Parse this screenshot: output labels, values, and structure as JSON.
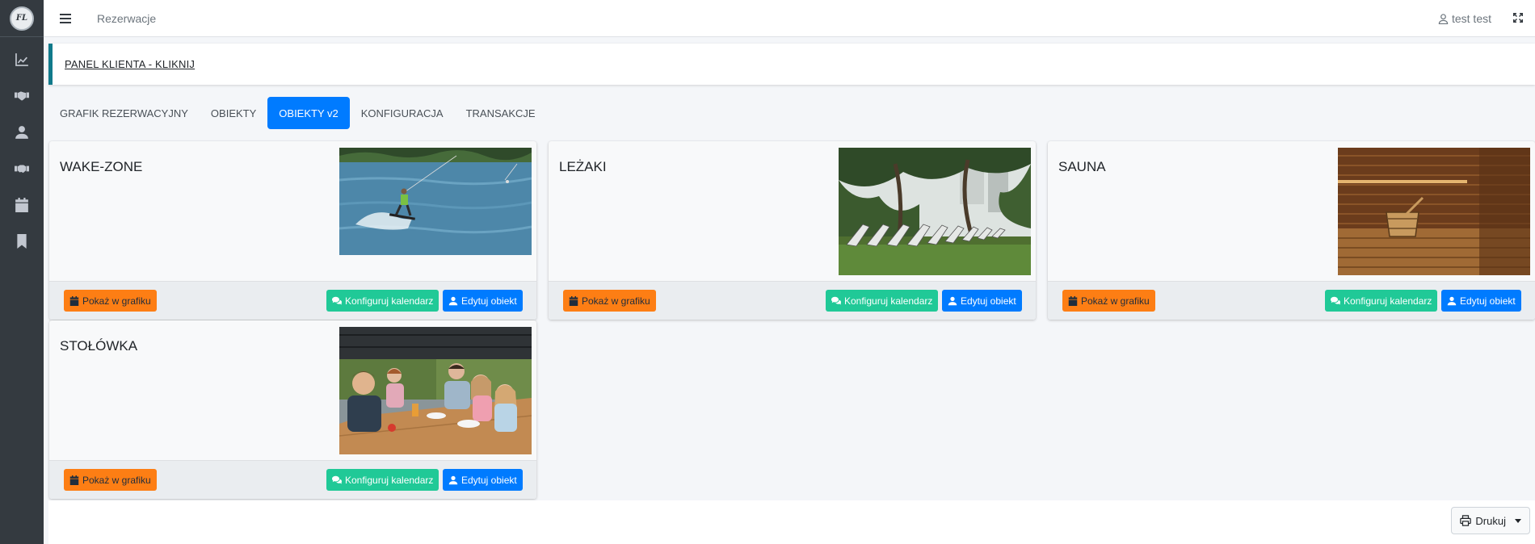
{
  "brand": {
    "logo_text": "FL"
  },
  "sidebar": {
    "items": [
      {
        "icon": "chart-line-icon"
      },
      {
        "icon": "handshake-icon"
      },
      {
        "icon": "user-icon"
      },
      {
        "icon": "handshake-alt-icon"
      },
      {
        "icon": "calendar-icon"
      },
      {
        "icon": "bookmark-icon"
      }
    ]
  },
  "header": {
    "title": "Rezerwacje",
    "user": "test test"
  },
  "callout": {
    "link": "PANEL KLIENTA - KLIKNIJ"
  },
  "tabs": [
    {
      "label": "GRAFIK REZERWACYJNY",
      "active": false
    },
    {
      "label": "OBIEKTY",
      "active": false
    },
    {
      "label": "OBIEKTY v2",
      "active": true
    },
    {
      "label": "KONFIGURACJA",
      "active": false
    },
    {
      "label": "TRANSAKCJE",
      "active": false
    }
  ],
  "buttons": {
    "show": "Pokaż w grafiku",
    "configure": "Konfiguruj kalendarz",
    "edit": "Edytuj obiekt"
  },
  "objects": [
    {
      "name": "WAKE-ZONE",
      "image": "wakeboard-photo"
    },
    {
      "name": "LEŻAKI",
      "image": "deckchairs-photo"
    },
    {
      "name": "SAUNA",
      "image": "sauna-photo"
    },
    {
      "name": "STOŁÓWKA",
      "image": "canteen-photo"
    }
  ],
  "footer": {
    "print": "Drukuj"
  },
  "colors": {
    "sidebar": "#343a40",
    "primary": "#007bff",
    "orange": "#fd7e14",
    "teal": "#20c997",
    "callout_border": "#117a8b"
  }
}
